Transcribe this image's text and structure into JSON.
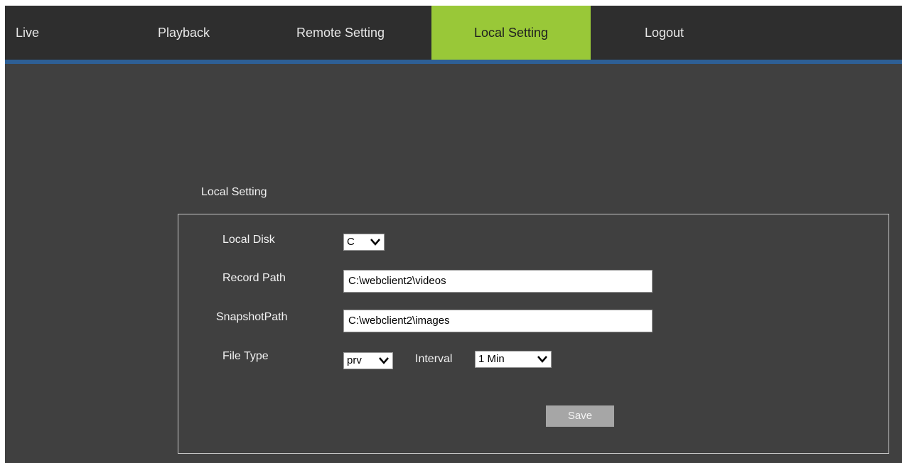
{
  "nav": {
    "items": [
      {
        "label": "Live"
      },
      {
        "label": "Playback"
      },
      {
        "label": "Remote Setting"
      },
      {
        "label": "Local Setting",
        "active": true
      },
      {
        "label": "Logout"
      }
    ]
  },
  "local_setting": {
    "title": "Local Setting",
    "local_disk": {
      "label": "Local Disk",
      "value": "C"
    },
    "record_path": {
      "label": "Record Path",
      "value": "C:\\webclient2\\videos"
    },
    "snapshot_path": {
      "label": "SnapshotPath",
      "value": "C:\\webclient2\\images"
    },
    "file_type": {
      "label": "File Type",
      "value": "prv"
    },
    "interval": {
      "label": "Interval",
      "value": "1 Min"
    },
    "save_label": "Save"
  },
  "colors": {
    "topbar": "#2e2e2e",
    "active_tab": "#99c838",
    "accent_line": "#2e5f95",
    "background": "#404040"
  },
  "icons": {
    "dropdown": "chevron-down-icon"
  }
}
